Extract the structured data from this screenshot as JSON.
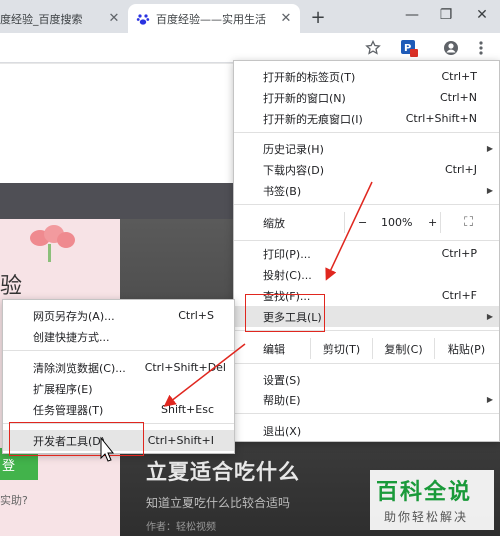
{
  "tabs": [
    {
      "title": "度经验_百度搜索",
      "close": "✕"
    },
    {
      "title": "百度经验——实用生活",
      "close": "✕"
    }
  ],
  "window": {
    "new_tab": "+",
    "minimize": "—",
    "maximize": "❐",
    "close": "✕"
  },
  "toolbar_icons": [
    "star-icon",
    "extension-icon",
    "profile-icon",
    "menu-icon"
  ],
  "page": {
    "hero_letter": "验",
    "green_button": "登",
    "hint": "实助?",
    "hero_title": "立夏适合吃什么",
    "hero_subtitle": "知道立夏吃什么比较合适吗",
    "hero_author": "作者：轻松视频"
  },
  "watermark": {
    "main": "百科全说",
    "sub": "助你轻松解决"
  },
  "main_menu": {
    "new_tab": {
      "label": "打开新的标签页(T)",
      "shortcut": "Ctrl+T"
    },
    "new_window": {
      "label": "打开新的窗口(N)",
      "shortcut": "Ctrl+N"
    },
    "incognito": {
      "label": "打开新的无痕窗口(I)",
      "shortcut": "Ctrl+Shift+N"
    },
    "history": {
      "label": "历史记录(H)"
    },
    "downloads": {
      "label": "下载内容(D)",
      "shortcut": "Ctrl+J"
    },
    "bookmarks": {
      "label": "书签(B)"
    },
    "zoom": {
      "label": "缩放",
      "minus": "−",
      "value": "100%",
      "plus": "+",
      "fullscreen": "⛶"
    },
    "print": {
      "label": "打印(P)...",
      "shortcut": "Ctrl+P"
    },
    "cast": {
      "label": "投射(C)..."
    },
    "find": {
      "label": "查找(F)...",
      "shortcut": "Ctrl+F"
    },
    "more_tools": {
      "label": "更多工具(L)"
    },
    "edit": {
      "label": "编辑",
      "cut": "剪切(T)",
      "copy": "复制(C)",
      "paste": "粘贴(P)"
    },
    "settings": {
      "label": "设置(S)"
    },
    "help": {
      "label": "帮助(E)"
    },
    "exit": {
      "label": "退出(X)"
    }
  },
  "sub_menu": {
    "save_as": {
      "label": "网页另存为(A)...",
      "shortcut": "Ctrl+S"
    },
    "shortcut": {
      "label": "创建快捷方式..."
    },
    "clear_data": {
      "label": "清除浏览数据(C)...",
      "shortcut": "Ctrl+Shift+Del"
    },
    "extensions": {
      "label": "扩展程序(E)"
    },
    "task_manager": {
      "label": "任务管理器(T)",
      "shortcut": "Shift+Esc"
    },
    "dev_tools": {
      "label": "开发者工具(D)",
      "shortcut": "Ctrl+Shift+I"
    }
  },
  "colors": {
    "annotation_red": "#e0271f",
    "watermark_green": "#1a9a3a"
  }
}
